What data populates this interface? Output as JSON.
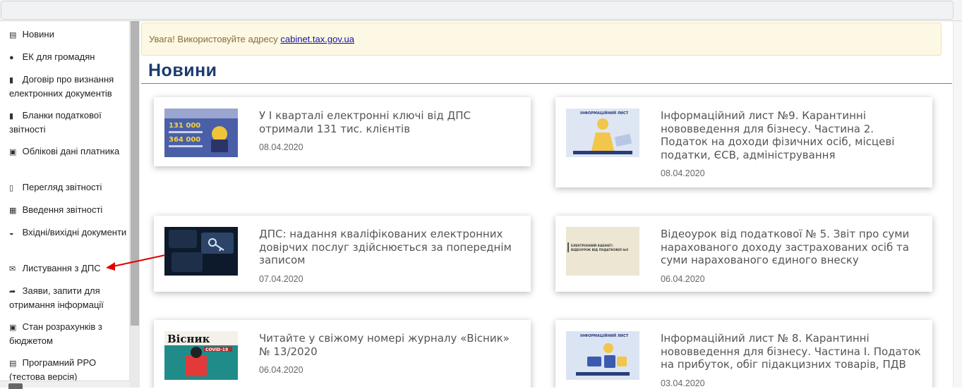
{
  "sidebar": {
    "items": [
      {
        "icon": "newspaper-icon",
        "glyph": "▤",
        "label": "Новини"
      },
      {
        "icon": "user-icon",
        "glyph": "●",
        "label": "ЕК для громадян"
      },
      {
        "icon": "book-icon",
        "glyph": "▮",
        "label": "Договір про визнання електронних документів"
      },
      {
        "icon": "book-icon",
        "glyph": "▮",
        "label": "Бланки податкової звітності"
      },
      {
        "icon": "id-card-icon",
        "glyph": "▣",
        "label": "Облікові дані платника"
      },
      {
        "icon": "document-icon",
        "glyph": "▯",
        "label": "Перегляд звітності"
      },
      {
        "icon": "document-edit-icon",
        "glyph": "▦",
        "label": "Введення звітності"
      },
      {
        "icon": "inbox-icon",
        "glyph": "◒",
        "label": "Вхідні/вихідні документи"
      },
      {
        "icon": "envelope-icon",
        "glyph": "✉",
        "label": "Листування з ДПС"
      },
      {
        "icon": "share-icon",
        "glyph": "➦",
        "label": "Заяви, запити для отримання інформації"
      },
      {
        "icon": "money-icon",
        "glyph": "▣",
        "label": "Стан розрахунків з бюджетом"
      },
      {
        "icon": "printer-icon",
        "glyph": "▤",
        "label": "Програмний РРО (тестова версія)"
      }
    ]
  },
  "alert": {
    "prefix": "Увага! Використовуйте адресу ",
    "link": "cabinet.tax.gov.ua"
  },
  "page_title": "Новини",
  "news": [
    {
      "title": "У І кварталі електронні ключі від ДПС отримали 131 тис. клієнтів",
      "date": "08.04.2020",
      "thumb_top": "131 000",
      "thumb_bottom": "364 000"
    },
    {
      "title": "Інформаційний лист №9. Карантинні нововведення для бізнесу. Частина 2. Податок на доходи фізичних осіб, місцеві податки, ЄСВ, адміністрування",
      "date": "08.04.2020",
      "thumb_top": "ІНФОРМАЦІЙНИЙ ЛИСТ"
    },
    {
      "title": "ДПС: надання кваліфікованих електронних довірчих послуг здійснюється за попереднім записом",
      "date": "07.04.2020"
    },
    {
      "title": "Відеоурок від податкової № 5. Звіт про суми нарахованого доходу застрахованих осіб та суми нарахованого єдиного внеску",
      "date": "06.04.2020",
      "thumb_top": "ЕЛЕКТРОННИЙ КАБІНЕТ:",
      "thumb_bottom": "ВІДЕОУРОК ВІД ПОДАТКОВОЇ №5"
    },
    {
      "title": "Читайте у свіжому номері журналу «Вісник» № 13/2020",
      "date": "06.04.2020",
      "thumb_top": "Вісник",
      "thumb_bottom": "COVID-19"
    },
    {
      "title": "Інформаційний лист № 8. Карантинні нововведення для бізнесу. Частина І. Податок на прибуток, обіг підакцизних товарів, ПДВ",
      "date": "03.04.2020",
      "thumb_top": "ІНФОРМАЦІЙНИЙ ЛИСТ"
    }
  ],
  "colors": {
    "title": "#1d3b6e",
    "alert_bg": "#fcf8e3",
    "arrow": "#e00000"
  }
}
